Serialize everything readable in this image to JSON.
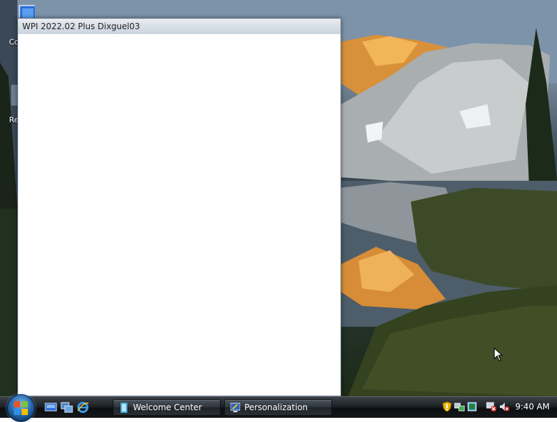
{
  "window": {
    "title": "WPI 2022.02 Plus Dixguel03"
  },
  "desktop": {
    "icons": [
      {
        "label": "Co",
        "icon": "computer-icon"
      },
      {
        "label": "Re",
        "icon": "recycle-bin-icon"
      }
    ]
  },
  "taskbar": {
    "start_icon": "windows-start-orb-icon",
    "quick_launch": [
      {
        "icon": "show-desktop-icon"
      },
      {
        "icon": "switch-windows-icon"
      },
      {
        "icon": "internet-explorer-icon"
      }
    ],
    "buttons": [
      {
        "label": "Welcome Center",
        "icon": "welcome-center-icon"
      },
      {
        "label": "Personalization",
        "icon": "personalization-icon"
      }
    ],
    "tray": {
      "icons": [
        "security-alert-icon",
        "network-icon",
        "volume-muted-icon"
      ],
      "clock": "9:40 AM"
    }
  },
  "colors": {
    "taskbar": "#1e2226",
    "window_title_bg": "#d7dee6",
    "accent": "#2a6fb5"
  }
}
